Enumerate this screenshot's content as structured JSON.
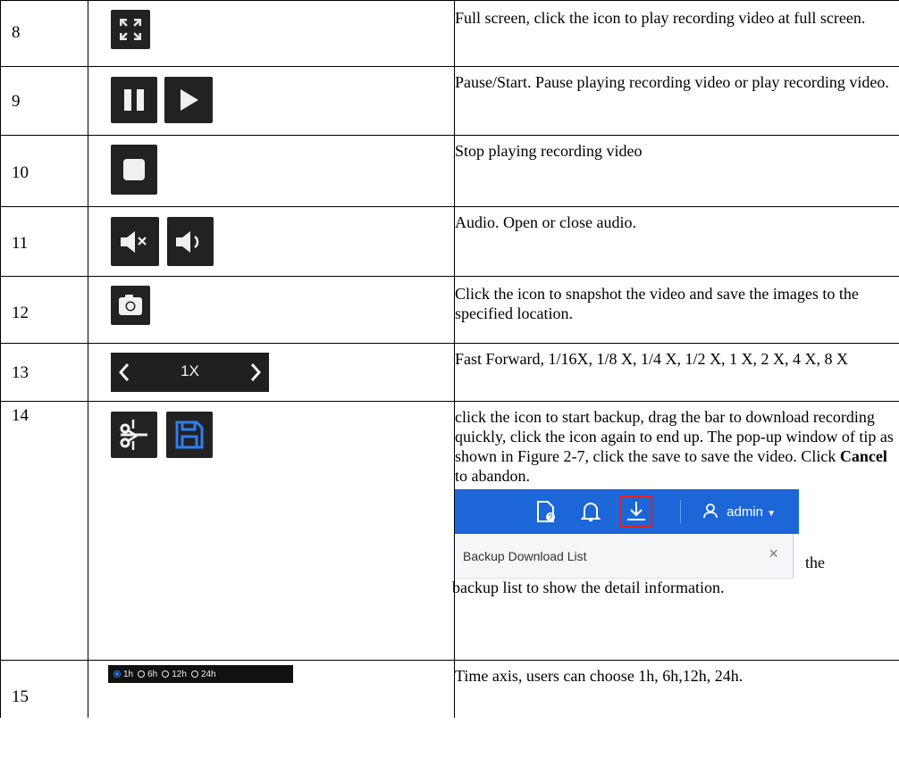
{
  "rows": [
    {
      "num": "8",
      "icon": "fullscreen-icon",
      "desc": "Full screen, click the icon to play recording video at full screen."
    },
    {
      "num": "9",
      "icon": "pause-play-icons",
      "desc": "Pause/Start. Pause playing recording video or play recording video."
    },
    {
      "num": "10",
      "icon": "stop-icon",
      "desc": "Stop playing recording video"
    },
    {
      "num": "11",
      "icon": "audio-icons",
      "desc": "Audio. Open or close audio."
    },
    {
      "num": "12",
      "icon": "camera-icon",
      "desc": "Click the icon to snapshot the video and save the images to the specified location."
    },
    {
      "num": "13",
      "icon": "speed-control",
      "speed_label": "1X",
      "desc": "Fast Forward, 1/16X, 1/8 X, 1/4 X, 1/2 X, 1 X, 2 X, 4 X, 8 X"
    },
    {
      "num": "14",
      "icon": "scissors-save-icons",
      "desc_pre": "click the icon to start backup, drag the bar to download recording quickly, click the icon again to end up. The pop-up window of tip as shown in Figure 2-7, click the save to save the video. Click ",
      "desc_bold": "Cancel",
      "desc_post": " to abandon.",
      "popup": {
        "user": "admin",
        "list_title": "Backup Download List",
        "close": "×"
      },
      "tail_word": "the",
      "tail_line": "backup list to show the detail information."
    },
    {
      "num": "15",
      "icon": "time-axis-radios",
      "radios": [
        {
          "label": "1h",
          "checked": true
        },
        {
          "label": "6h",
          "checked": false
        },
        {
          "label": "12h",
          "checked": false
        },
        {
          "label": "24h",
          "checked": false
        }
      ],
      "desc": "Time axis, users can choose 1h, 6h,12h, 24h."
    }
  ],
  "colors": {
    "icon_bg": "#222222",
    "popup_bar": "#1c66d8",
    "highlight": "#e22222",
    "save_blue": "#2f7ef0"
  }
}
